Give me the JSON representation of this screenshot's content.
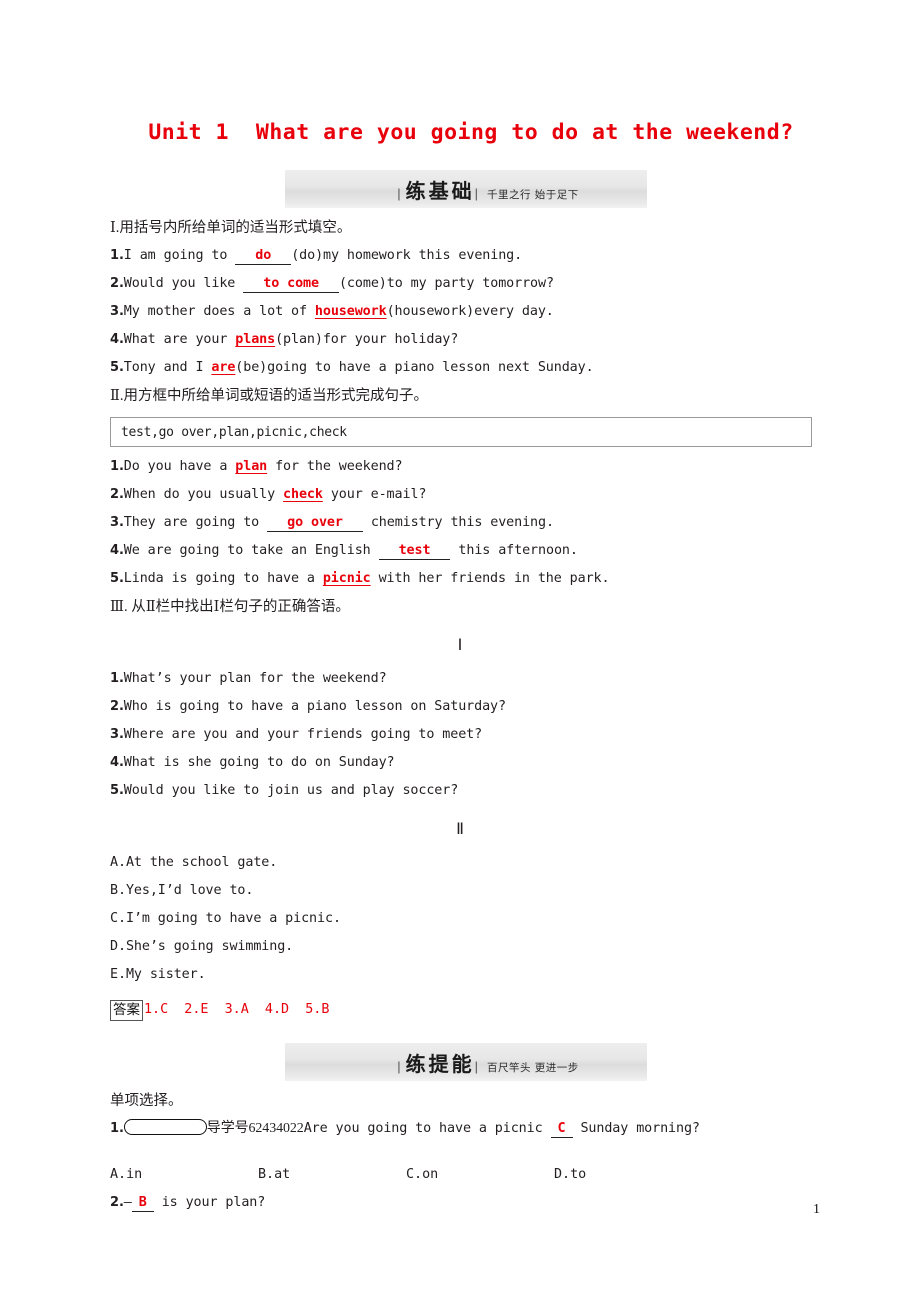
{
  "document": {
    "title": "Unit 1  What are you going to do at the weekend?",
    "page_number": "1",
    "accent_color": "#e8000b"
  },
  "sections": [
    {
      "banner_title": "练基础",
      "banner_sub": "千里之行  始于足下"
    },
    {
      "banner_title": "练提能",
      "banner_sub": "百尺竿头  更进一步"
    }
  ],
  "part1": {
    "heading": "Ⅰ.用括号内所给单词的适当形式填空。",
    "items": [
      {
        "num": "1.",
        "pre": "I am going to ",
        "answer": "do",
        "blank": true,
        "post": "(do)my homework this evening."
      },
      {
        "num": "2.",
        "pre": "Would you like ",
        "answer": "to come",
        "blank": true,
        "post": "(come)to my party tomorrow?"
      },
      {
        "num": "3.",
        "pre": "My mother does a lot of ",
        "answer": "housework",
        "blank": false,
        "post": "(housework)every day."
      },
      {
        "num": "4.",
        "pre": "What are your ",
        "answer": "plans",
        "blank": false,
        "post": "(plan)for your holiday?"
      },
      {
        "num": "5.",
        "pre": "Tony and I ",
        "answer": "are",
        "blank": false,
        "post": "(be)going to have a piano lesson next Sunday."
      }
    ]
  },
  "part2": {
    "heading": "Ⅱ.用方框中所给单词或短语的适当形式完成句子。",
    "wordbank": "test,go over,plan,picnic,check",
    "items": [
      {
        "num": "1.",
        "pre": "Do you have a ",
        "answer": "plan",
        "blank": false,
        "post": " for the weekend?"
      },
      {
        "num": "2.",
        "pre": "When do you usually ",
        "answer": "check",
        "blank": false,
        "post": " your e-mail?"
      },
      {
        "num": "3.",
        "pre": "They are going to ",
        "answer": "go over",
        "blank": true,
        "post": " chemistry this evening."
      },
      {
        "num": "4.",
        "pre": "We are going to take an English ",
        "answer": "test",
        "blank": true,
        "post": " this afternoon."
      },
      {
        "num": "5.",
        "pre": "Linda is going to have a ",
        "answer": "picnic",
        "blank": false,
        "post": " with her friends in the park."
      }
    ]
  },
  "part3": {
    "heading": "Ⅲ. 从Ⅱ栏中找出Ⅰ栏句子的正确答语。",
    "column1_label": "Ⅰ",
    "column1": [
      {
        "num": "1.",
        "text": "What’s your plan for the weekend?"
      },
      {
        "num": "2.",
        "text": "Who is going to have a piano lesson on Saturday?"
      },
      {
        "num": "3.",
        "text": "Where are you and your friends going to meet?"
      },
      {
        "num": "4.",
        "text": "What is she going to do on Sunday?"
      },
      {
        "num": "5.",
        "text": "Would you like to join us and play soccer?"
      }
    ],
    "column2_label": "Ⅱ",
    "column2": [
      {
        "num": "A.",
        "text": "At the school gate."
      },
      {
        "num": "B.",
        "text": "Yes,I’d love to."
      },
      {
        "num": "C.",
        "text": "I’m going to have a picnic."
      },
      {
        "num": "D.",
        "text": "She’s going swimming."
      },
      {
        "num": "E.",
        "text": "My sister."
      }
    ],
    "answer_tag": "答案",
    "answer_values": "1.C  2.E  3.A  4.D  5.B"
  },
  "part4": {
    "heading": "单项选择。",
    "item1": {
      "num": "1.",
      "daoxue_label": "导学号",
      "daoxue_number": "62434022",
      "pre": "Are you going to have a picnic ",
      "answer": "C",
      "post": " Sunday morning?",
      "options": [
        "A.in",
        "B.at",
        "C.on",
        "D.to"
      ]
    },
    "item2": {
      "num": "2.",
      "pre": "—",
      "answer": "B",
      "post": " is your plan?"
    }
  }
}
